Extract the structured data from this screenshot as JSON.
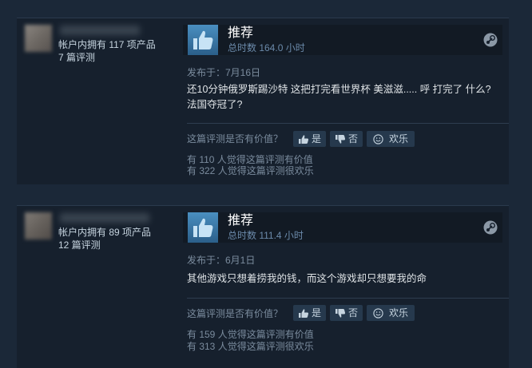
{
  "reviews": [
    {
      "owned": "帐户内拥有 117 项产品",
      "review_count": "7 篇评测",
      "verdict": "推荐",
      "hours": "总时数 164.0 小时",
      "posted": "发布于：7月16日",
      "content": "还10分钟俄罗斯踢沙特 这把打完看世界杯 美滋滋..... 呼 打完了 什么?法国夺冠了?",
      "helpful_question": "这篇评测是否有价值？",
      "yes_label": "是",
      "no_label": "否",
      "funny_label": "欢乐",
      "helpful_count": "有 110 人觉得这篇评测有价值",
      "funny_count": "有 322 人觉得这篇评测很欢乐"
    },
    {
      "owned": "帐户内拥有 89 项产品",
      "review_count": "12 篇评测",
      "verdict": "推荐",
      "hours": "总时数 111.4 小时",
      "posted": "发布于：6月1日",
      "content": "其他游戏只想着捞我的钱，而这个游戏却只想要我的命",
      "helpful_question": "这篇评测是否有价值？",
      "yes_label": "是",
      "no_label": "否",
      "funny_label": "欢乐",
      "helpful_count": "有 159 人觉得这篇评测有价值",
      "funny_count": "有 313 人觉得这篇评测很欢乐"
    }
  ],
  "icons": {
    "verdict": "thumbs-up-icon",
    "platform": "steam-logo-icon",
    "yes": "thumbs-up-icon",
    "no": "thumbs-down-icon",
    "funny": "smiley-icon"
  },
  "colors": {
    "page_bg": "#1b2838",
    "card_bg": "#16202d",
    "accent": "#4a8fc0",
    "button_bg": "#26394d"
  }
}
